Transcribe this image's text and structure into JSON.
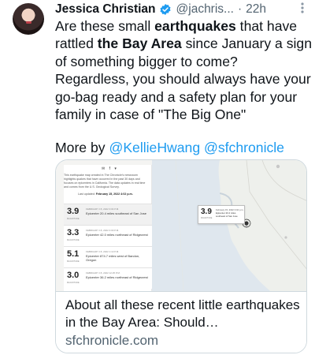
{
  "tweet": {
    "display_name": "Jessica Christian",
    "handle": "@jachris...",
    "separator": "·",
    "time": "22h",
    "text": {
      "t1": "Are these small ",
      "b1": "earthquakes",
      "t2": " that have rattled ",
      "b2": "the Bay Area",
      "t3": " since January a sign of something bigger to come? Regardless, you should always have your go-bag ready and a safety plan for your family in case of \"The Big One\""
    },
    "more_by_prefix": "More by ",
    "mention_1": "@KellieHwang",
    "mention_2": "@sfchronicle",
    "icons": {
      "verified": "verified-badge-icon",
      "more": "more-options-icon",
      "avatar": "profile-photo"
    }
  },
  "card": {
    "title": "About all these recent little earthquakes in the Bay Area: Should…",
    "domain": "sfchronicle.com",
    "preview": {
      "share_icons": "✉ f ▾",
      "intro": "This earthquake map created in The Chronicle's newsroom highlights quakes that have occurred in the past 30 days and focuses on epicenters in California. The data updates in real time and comes from the U.S. Geological Survey.",
      "updated_label": "Last updated: ",
      "updated_value": "February 15, 2022 4:02 p.m.",
      "quakes": [
        {
          "mag": "3.9",
          "sub": "MAGNITUDE",
          "date": "FEBRUARY 15, 2022 3:04 P.M.",
          "desc": "Epicenter 20.4 miles southeast of San Jose"
        },
        {
          "mag": "3.3",
          "sub": "MAGNITUDE",
          "date": "FEBRUARY 15, 2022 4:00 P.M.",
          "desc": "Epicenter 42.0 miles northeast of Ridgecrest"
        },
        {
          "mag": "5.1",
          "sub": "MAGNITUDE",
          "date": "FEBRUARY 15, 2022 1:13 P.M.",
          "desc": "Epicenter 874.7 miles west of Bandon, Oregon"
        },
        {
          "mag": "3.0",
          "sub": "MAGNITUDE",
          "date": "FEBRUARY 15, 2022 12:25 P.M.",
          "desc": "Epicenter 36.2 miles northeast of Ridgecrest"
        }
      ],
      "popup": {
        "mag": "3.9",
        "sub": "MAGNITUDE",
        "date": "February 15, 2022 3:04 p.m.",
        "desc": "Epicenter 20.4 miles southeast of San Jose"
      }
    }
  },
  "colors": {
    "link": "#1d9bf0",
    "secondary_text": "#536471",
    "border": "#cfd9de",
    "verified_badge": "#1d9bf0"
  }
}
